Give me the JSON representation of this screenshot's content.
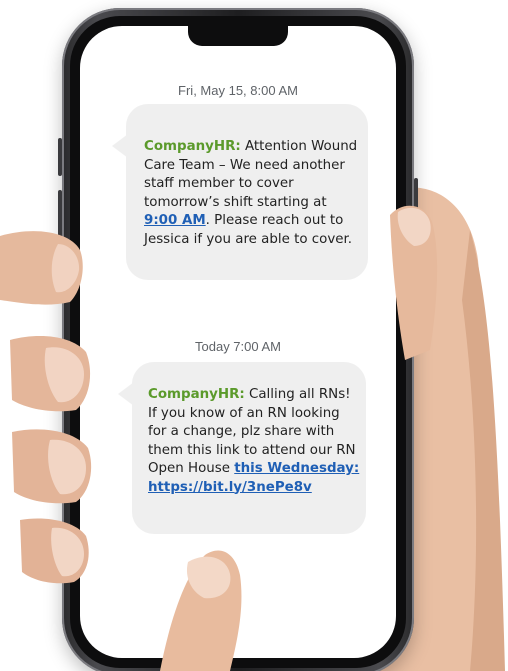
{
  "messages": [
    {
      "timestamp": "Fri, May 15, 8:00 AM",
      "sender": "CompanyHR:",
      "text_before": " Attention Wound Care Team – We need another staff member to cover tomorrow’s shift starting at ",
      "link_text": "9:00 AM",
      "text_after": ". Please reach out to Jessica if you are able to cover."
    },
    {
      "timestamp": "Today 7:00 AM",
      "sender": "CompanyHR:",
      "text_before": " Calling all RNs! If you know of an RN looking for a change, plz share with them this link to attend our RN Open House ",
      "link_text": "this Wednesday:",
      "link_url_text": "https://bit.ly/3nePe8v"
    }
  ],
  "colors": {
    "sender": "#5b9a2b",
    "link": "#1f5fb5",
    "bubble": "#efefef"
  }
}
